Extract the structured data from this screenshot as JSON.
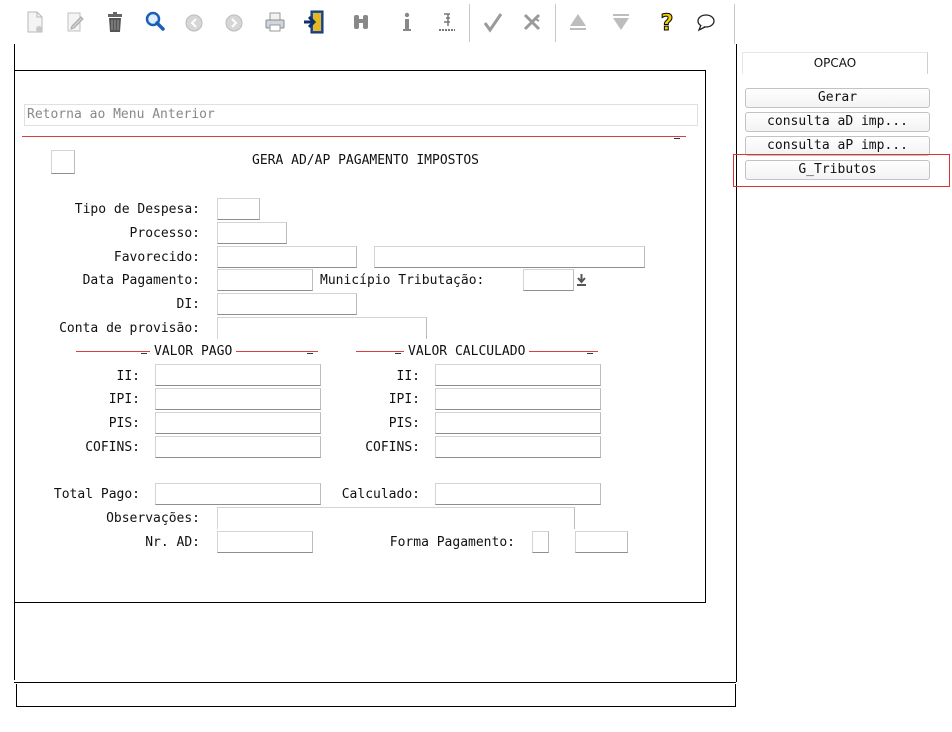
{
  "toolbar": {
    "icons": [
      "new-document-icon",
      "edit-icon",
      "trash-icon",
      "search-icon",
      "previous-icon",
      "next-icon",
      "print-icon",
      "exit-icon",
      "binoculars-icon",
      "info-icon",
      "ruler-icon",
      "confirm-icon",
      "cancel-icon",
      "scroll-up-icon",
      "scroll-down-icon",
      "help-icon",
      "chat-icon"
    ]
  },
  "menu": {
    "return_label": "Retorna ao Menu Anterior"
  },
  "form": {
    "title": "GERA AD/AP PAGAMENTO IMPOSTOS",
    "labels": {
      "tipo_despesa": "Tipo de Despesa:",
      "processo": "Processo:",
      "favorecido": "Favorecido:",
      "data_pagamento": "Data Pagamento:",
      "municipio": "Município Tributação:",
      "di": "DI:",
      "conta_provisao": "Conta de provisão:",
      "total_pago": "Total Pago:",
      "calculado": "Calculado:",
      "observacoes": "Observações:",
      "nr_ad": "Nr. AD:",
      "forma_pagamento": "Forma Pagamento:"
    },
    "valor_pago": {
      "title": "VALOR PAGO",
      "ii": "II:",
      "ipi": "IPI:",
      "pis": "PIS:",
      "cofins": "COFINS:"
    },
    "valor_calculado": {
      "title": "VALOR CALCULADO",
      "ii": "II:",
      "ipi": "IPI:",
      "pis": "PIS:",
      "cofins": "COFINS:"
    }
  },
  "options": {
    "header": "OPCAO",
    "buttons": [
      "Gerar",
      "consulta aD imp...",
      "consulta aP imp...",
      "G_Tributos"
    ],
    "highlight_color": "#e03030"
  }
}
